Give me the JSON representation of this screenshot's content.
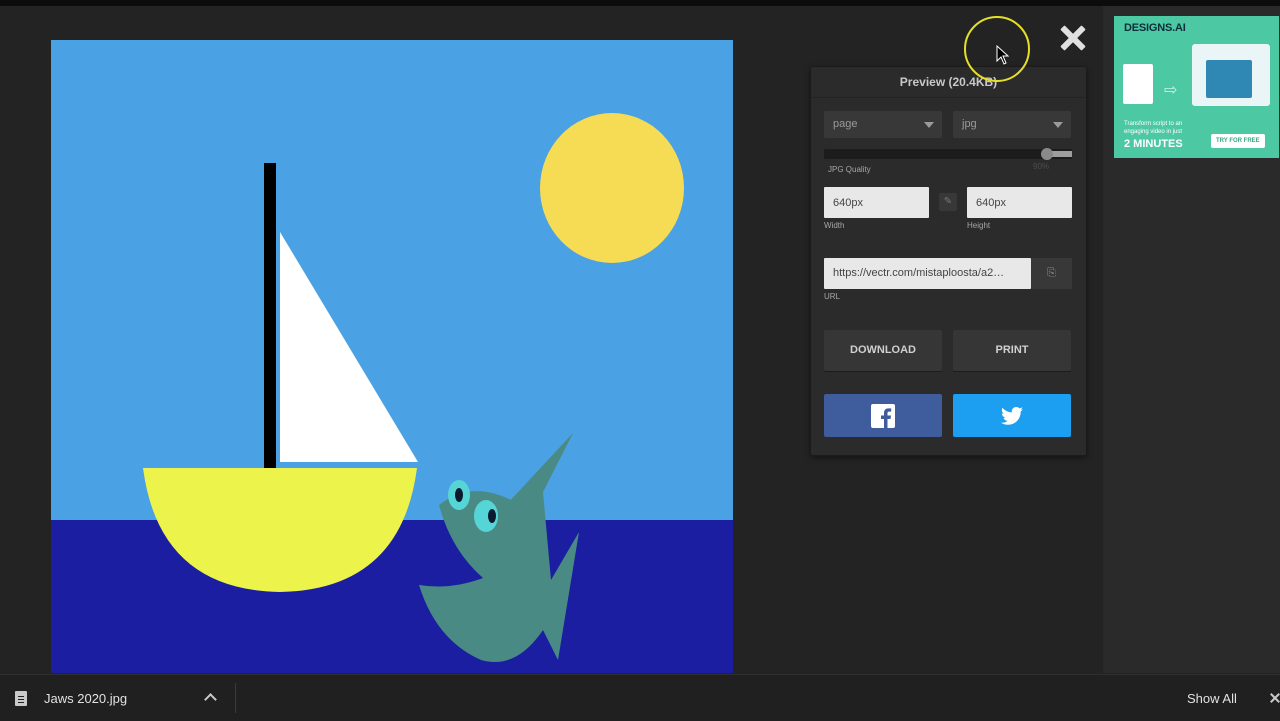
{
  "preview": {
    "title": "Preview (20.4KB)",
    "selects": {
      "area": "page",
      "format": "jpg"
    },
    "quality": {
      "label": "JPG Quality",
      "value_label": "90%",
      "value": 0.9
    },
    "width": {
      "value": "640px",
      "label": "Width"
    },
    "height": {
      "value": "640px",
      "label": "Height"
    },
    "url": {
      "value": "https://vectr.com/mistaploosta/a2…",
      "label": "URL"
    },
    "buttons": {
      "download": "DOWNLOAD",
      "print": "PRINT"
    },
    "social": {
      "facebook_icon": "facebook-icon",
      "twitter_icon": "twitter-icon"
    },
    "colors": {
      "facebook": "#3f5c9c",
      "twitter": "#1c9ff0"
    }
  },
  "canvas_colors": {
    "sky": "#4aa1e4",
    "sea": "#1b1ea0",
    "sun": "#f6dc55",
    "hull": "#ecf34b",
    "sail": "#ffffff",
    "mast": "#000000",
    "shark": "#4a8a85"
  },
  "ad": {
    "logo": "DESIGNS.AI",
    "tagline": "Transform script to an engaging video in just",
    "minutes": "2 MINUTES",
    "cta": "TRY FOR FREE"
  },
  "download_bar": {
    "file_name": "Jaws 2020.jpg",
    "show_all": "Show All"
  },
  "icons": {
    "close": "close-icon",
    "lock": "link-icon",
    "copy": "copy-icon",
    "file": "file-icon"
  }
}
